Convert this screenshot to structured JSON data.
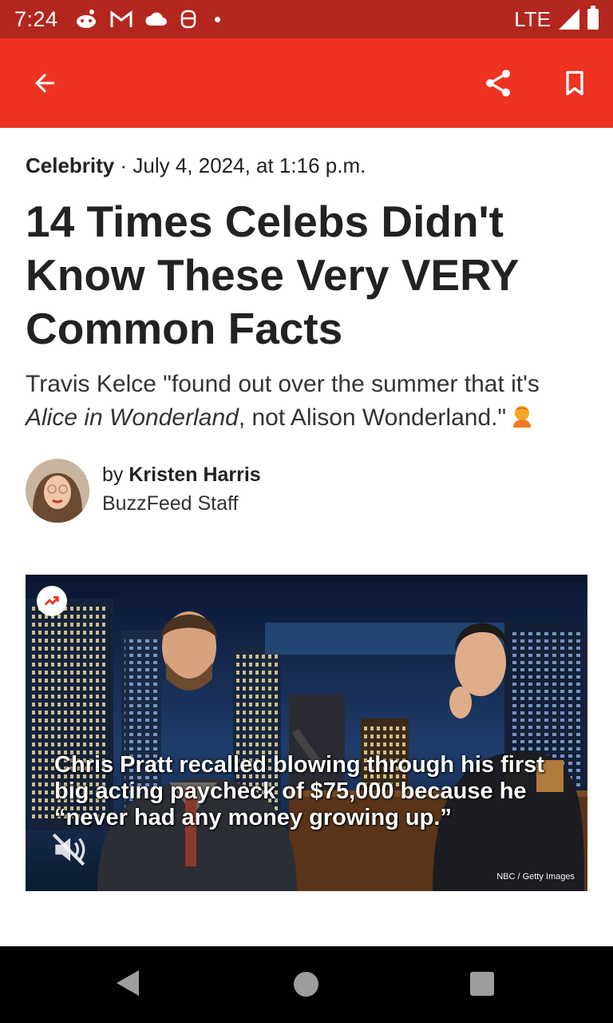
{
  "status_bar": {
    "time": "7:24",
    "network": "LTE",
    "notification_icons": [
      "reddit-icon",
      "gmail-icon",
      "cloud-icon",
      "app-icon"
    ]
  },
  "app_bar": {
    "color": "#ee3322",
    "icons": [
      "arrow-left-icon",
      "share-icon",
      "bookmark-icon"
    ]
  },
  "article": {
    "category": "Celebrity",
    "date_separator": " · ",
    "date": "July 4, 2024, at 1:16 p.m.",
    "headline": "14 Times Celebs Didn't Know These Very VERY Common Facts",
    "dek_prefix": "Travis Kelce \"found out over the summer that it's ",
    "dek_italic": "Alice in Wonderland",
    "dek_suffix": ", not Alison Wonderland.\"",
    "author": {
      "by_label": "by ",
      "name": "Kristen Harris",
      "role": "BuzzFeed Staff"
    }
  },
  "media": {
    "caption": "Chris Pratt recalled blowing through his first big acting paycheck of $75,000 because he “never had any money growing up.”",
    "credit": "NBC / Getty Images",
    "muted": true
  },
  "nav_bar": {
    "buttons": [
      "back",
      "home",
      "recents"
    ]
  }
}
